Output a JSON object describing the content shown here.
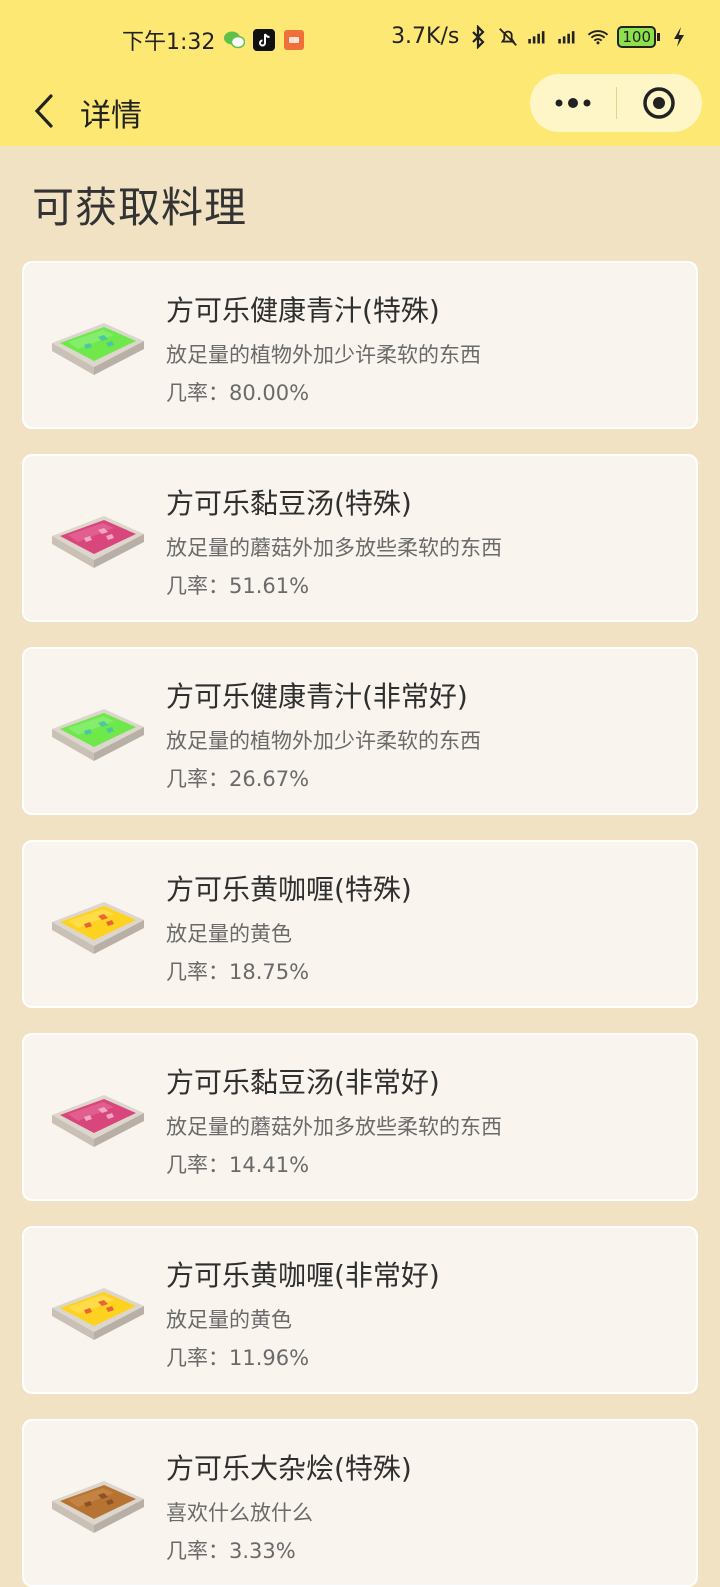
{
  "status": {
    "time": "下午1:32",
    "net_speed": "3.7K/s",
    "battery": "100"
  },
  "nav": {
    "title": "详情"
  },
  "section": {
    "title": "可获取料理"
  },
  "dishes": [
    {
      "name": "方可乐健康青汁(特殊)",
      "desc": "放足量的植物外加少许柔软的东西",
      "rate": "几率：80.00%",
      "color": "green"
    },
    {
      "name": "方可乐黏豆汤(特殊)",
      "desc": "放足量的蘑菇外加多放些柔软的东西",
      "rate": "几率：51.61%",
      "color": "pink"
    },
    {
      "name": "方可乐健康青汁(非常好)",
      "desc": "放足量的植物外加少许柔软的东西",
      "rate": "几率：26.67%",
      "color": "green"
    },
    {
      "name": "方可乐黄咖喱(特殊)",
      "desc": "放足量的黄色",
      "rate": "几率：18.75%",
      "color": "yellow"
    },
    {
      "name": "方可乐黏豆汤(非常好)",
      "desc": "放足量的蘑菇外加多放些柔软的东西",
      "rate": "几率：14.41%",
      "color": "pink"
    },
    {
      "name": "方可乐黄咖喱(非常好)",
      "desc": "放足量的黄色",
      "rate": "几率：11.96%",
      "color": "yellow"
    },
    {
      "name": "方可乐大杂烩(特殊)",
      "desc": "喜欢什么放什么",
      "rate": "几率：3.33%",
      "color": "brown"
    }
  ],
  "icons": {
    "back": "chevron-left-icon",
    "more": "more-dots-icon",
    "target": "target-icon",
    "wechat": "wechat-icon",
    "tiktok": "tiktok-icon",
    "mi": "mi-icon",
    "bluetooth": "bluetooth-icon",
    "mute": "bell-off-icon",
    "signal": "signal-icon",
    "wifi": "wifi-icon",
    "battery": "battery-icon",
    "charging": "charging-icon"
  },
  "colors": {
    "header_bg": "#fee874",
    "page_bg": "#f1e2c4",
    "card_bg": "#f9f4ee",
    "green_soup": "#6ee84a",
    "pink_soup": "#d8467c",
    "yellow_soup": "#ffd21f",
    "brown_soup": "#b77332"
  }
}
